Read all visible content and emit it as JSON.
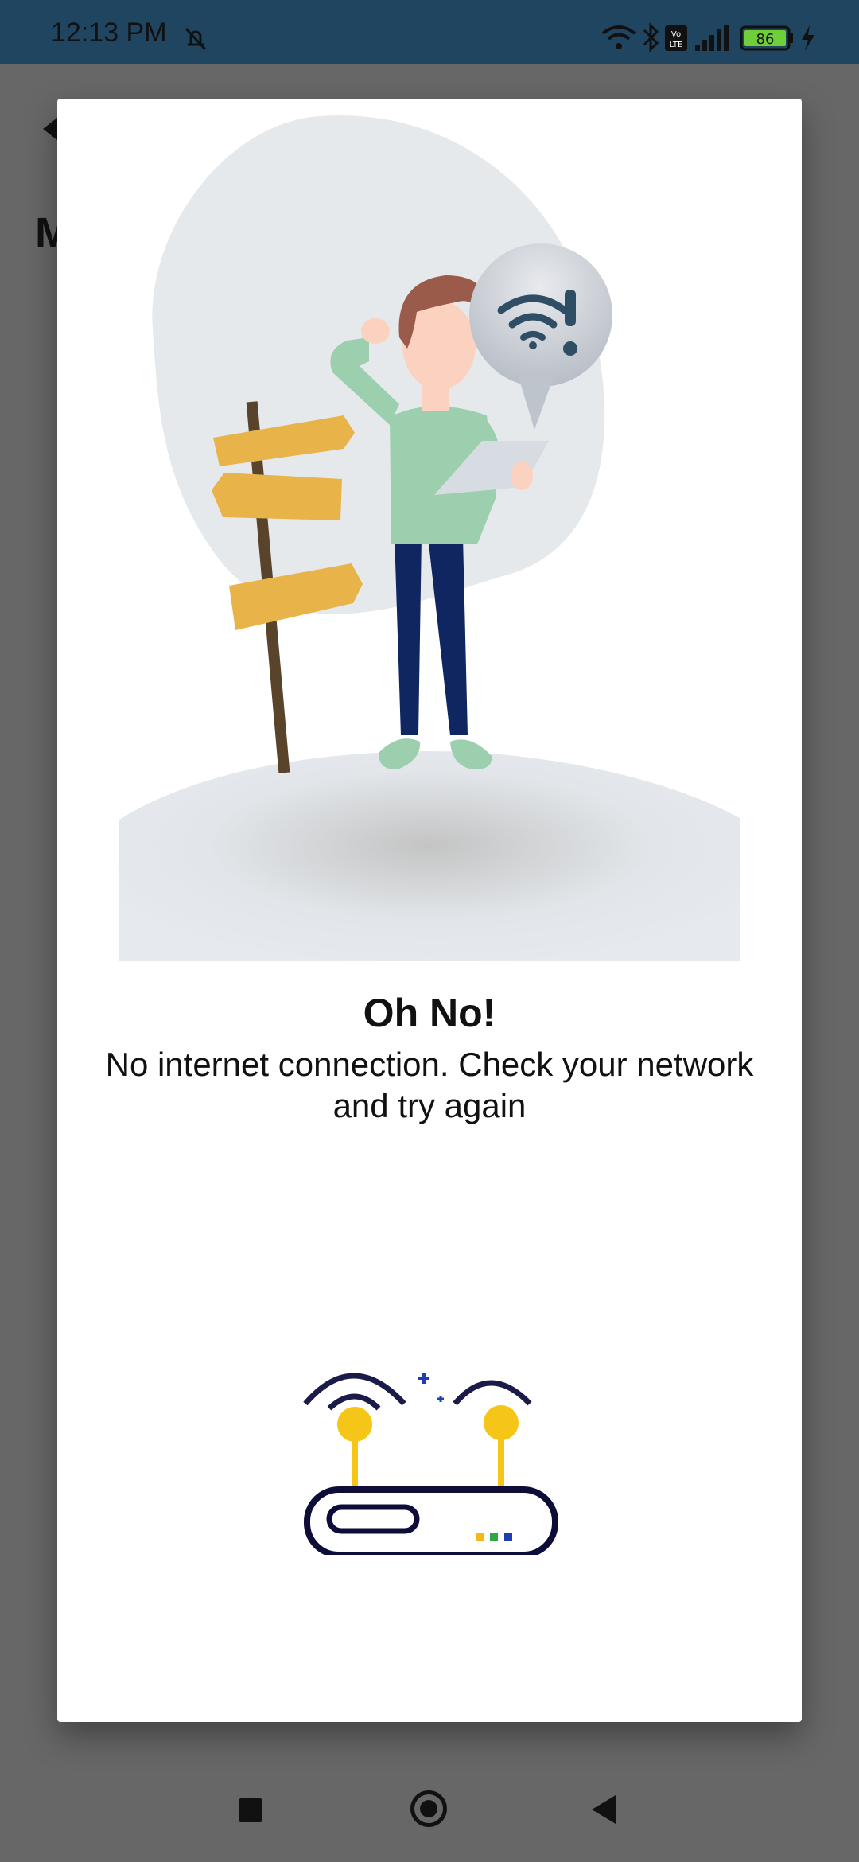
{
  "status_bar": {
    "time": "12:13 PM",
    "battery_level": "86",
    "icons": [
      "do-not-disturb-icon",
      "wifi-icon",
      "bluetooth-icon",
      "volte-icon",
      "signal-icon",
      "battery-icon",
      "charging-icon"
    ]
  },
  "background_app": {
    "title_fragment": "M"
  },
  "dialog": {
    "title": "Oh No!",
    "message": "No internet connection. Check your network and try again"
  },
  "colors": {
    "status_bar_bg": "#1f4560",
    "scrim": "#676767",
    "dialog_bg": "#ffffff",
    "router_yellow": "#f5c518",
    "router_navy": "#1b1b4a"
  },
  "nav_bar": {
    "buttons": [
      "recents-button",
      "home-button",
      "back-button"
    ]
  }
}
